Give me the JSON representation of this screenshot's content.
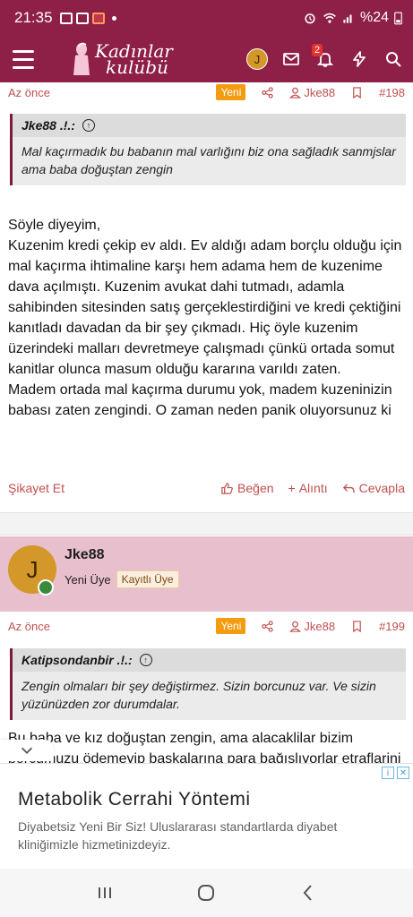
{
  "status_bar": {
    "time": "21:35",
    "battery": "%24"
  },
  "header": {
    "logo_line1": "Kadınlar",
    "logo_line2": "kulübü",
    "user_initial": "J",
    "notification_count": "2"
  },
  "post1": {
    "time": "Az önce",
    "new_badge": "Yeni",
    "author": "Jke88",
    "number": "#198",
    "quote_author": "Jke88 .!.:",
    "quote_text": "Mal kaçırmadık bu babanın mal varlığını biz ona sağladık sanmjslar ama baba doğuştan zengin",
    "body": "Söyle diyeyim,\nKuzenim kredi çekip ev aldı. Ev aldığı adam borçlu olduğu için mal kaçırma ihtimaline karşı hem adama hem de kuzenime dava açılmıştı. Kuzenim avukat dahi tutmadı, adamla sahibinden sitesinden satış gerçeklestirdiğini ve kredi çektiğini kanıtladı davadan da bir şey çıkmadı. Hiç öyle kuzenim üzerindeki malları devretmeye çalışmadı çünkü ortada somut kanitlar olunca masum olduğu kararına varıldı zaten.\nMadem ortada mal kaçırma durumu yok, madem kuzeninizin babası zaten zengindi. O zaman neden panik oluyorsunuz ki",
    "report_label": "Şikayet Et",
    "like_label": "Beğen",
    "quote_label": "Alıntı",
    "reply_label": "Cevapla"
  },
  "user2": {
    "initial": "J",
    "name": "Jke88",
    "rank": "Yeni Üye",
    "tag": "Kayıtlı Üye"
  },
  "post2": {
    "time": "Az önce",
    "new_badge": "Yeni",
    "author": "Jke88",
    "number": "#199",
    "quote_author": "Katipsondanbir .!.:",
    "quote_text": "Zengin olmaları bir şey değiştirmez. Sizin borcunuz var. Ve sizin yüzünüzden zor durumdalar.",
    "body": "Bu baba ve kız doğuştan zengin, ama alacaklilar bizim\nborcumuzu ödemeyip başkalarına para bağışlıyorlar etraflarini"
  },
  "ad": {
    "title": "Metabolik Cerrahi Yöntemi",
    "description": "Diyabetsiz Yeni Bir Siz! Uluslararası standartlarda diyabet kliniğimizle hizmetinizdeyiz."
  },
  "colors": {
    "brand": "#8e1f47",
    "accent_text": "#c0504f",
    "badge": "#f39c12",
    "user_card_bg": "#e8bfcd"
  }
}
